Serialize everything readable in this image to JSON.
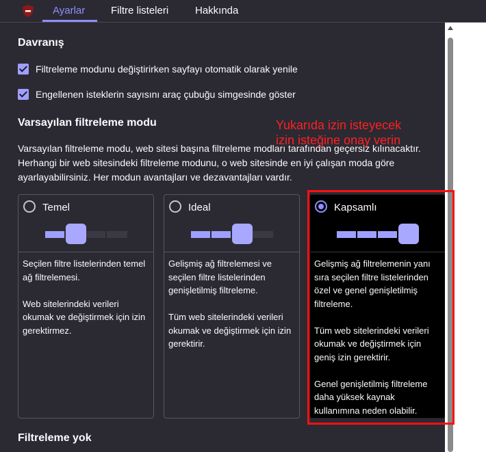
{
  "tabs": [
    {
      "label": "Ayarlar",
      "active": true
    },
    {
      "label": "Filtre listeleri",
      "active": false
    },
    {
      "label": "Hakkında",
      "active": false
    }
  ],
  "sections": {
    "behavior_heading": "Davranış",
    "checkboxes": [
      {
        "label": "Filtreleme modunu değiştirirken sayfayı otomatik olarak yenile",
        "checked": true
      },
      {
        "label": "Engellenen isteklerin sayısını araç çubuğu simgesinde göster",
        "checked": true
      }
    ],
    "default_mode_heading": "Varsayılan filtreleme modu",
    "description": "Varsayılan filtreleme modu, web sitesi başına filtreleme modları tarafından geçersiz kılınacaktır. Herhangi bir web sitesindeki filtreleme modunu, o web sitesinde en iyi çalışan moda göre ayarlayabilirsiniz. Her modun avantajları ve dezavantajları vardır.",
    "no_filtering_heading": "Filtreleme yok"
  },
  "modes": [
    {
      "title": "Temel",
      "selected": false,
      "level": 2,
      "paragraphs": [
        "Seçilen filtre listelerinden temel ağ filtrelemesi.",
        "Web sitelerindeki verileri okumak ve değiştirmek için izin gerektirmez."
      ]
    },
    {
      "title": "Ideal",
      "selected": false,
      "level": 3,
      "paragraphs": [
        "Gelişmiş ağ filtrelemesi ve seçilen filtre listelerinden genişletilmiş filtreleme.",
        "Tüm web sitelerindeki verileri okumak ve değiştirmek için izin gerektirir."
      ]
    },
    {
      "title": "Kapsamlı",
      "selected": true,
      "level": 4,
      "paragraphs": [
        "Gelişmiş ağ filtrelemenin yanı sıra seçilen filtre listelerinden özel ve genel genişletilmiş filtreleme.",
        "Tüm web sitelerindeki verileri okumak ve değiştirmek için geniş izin gerektirir.",
        "Genel genişletilmiş filtreleme daha yüksek kaynak kullanımına neden olabilir."
      ]
    }
  ],
  "annotation": {
    "line1": "Yukarıda izin isteyecek",
    "line2": "izin isteğine onay verin",
    "color": "#ff1010"
  },
  "colors": {
    "background": "#2b2a33",
    "accent": "#8f8fff",
    "selected_card": "#000000"
  },
  "icons": {
    "logo": "ublock-shield-icon",
    "checkbox": "checkmark-icon",
    "radio": "radio-icon",
    "scroll": "scroll-up-arrow-icon"
  }
}
